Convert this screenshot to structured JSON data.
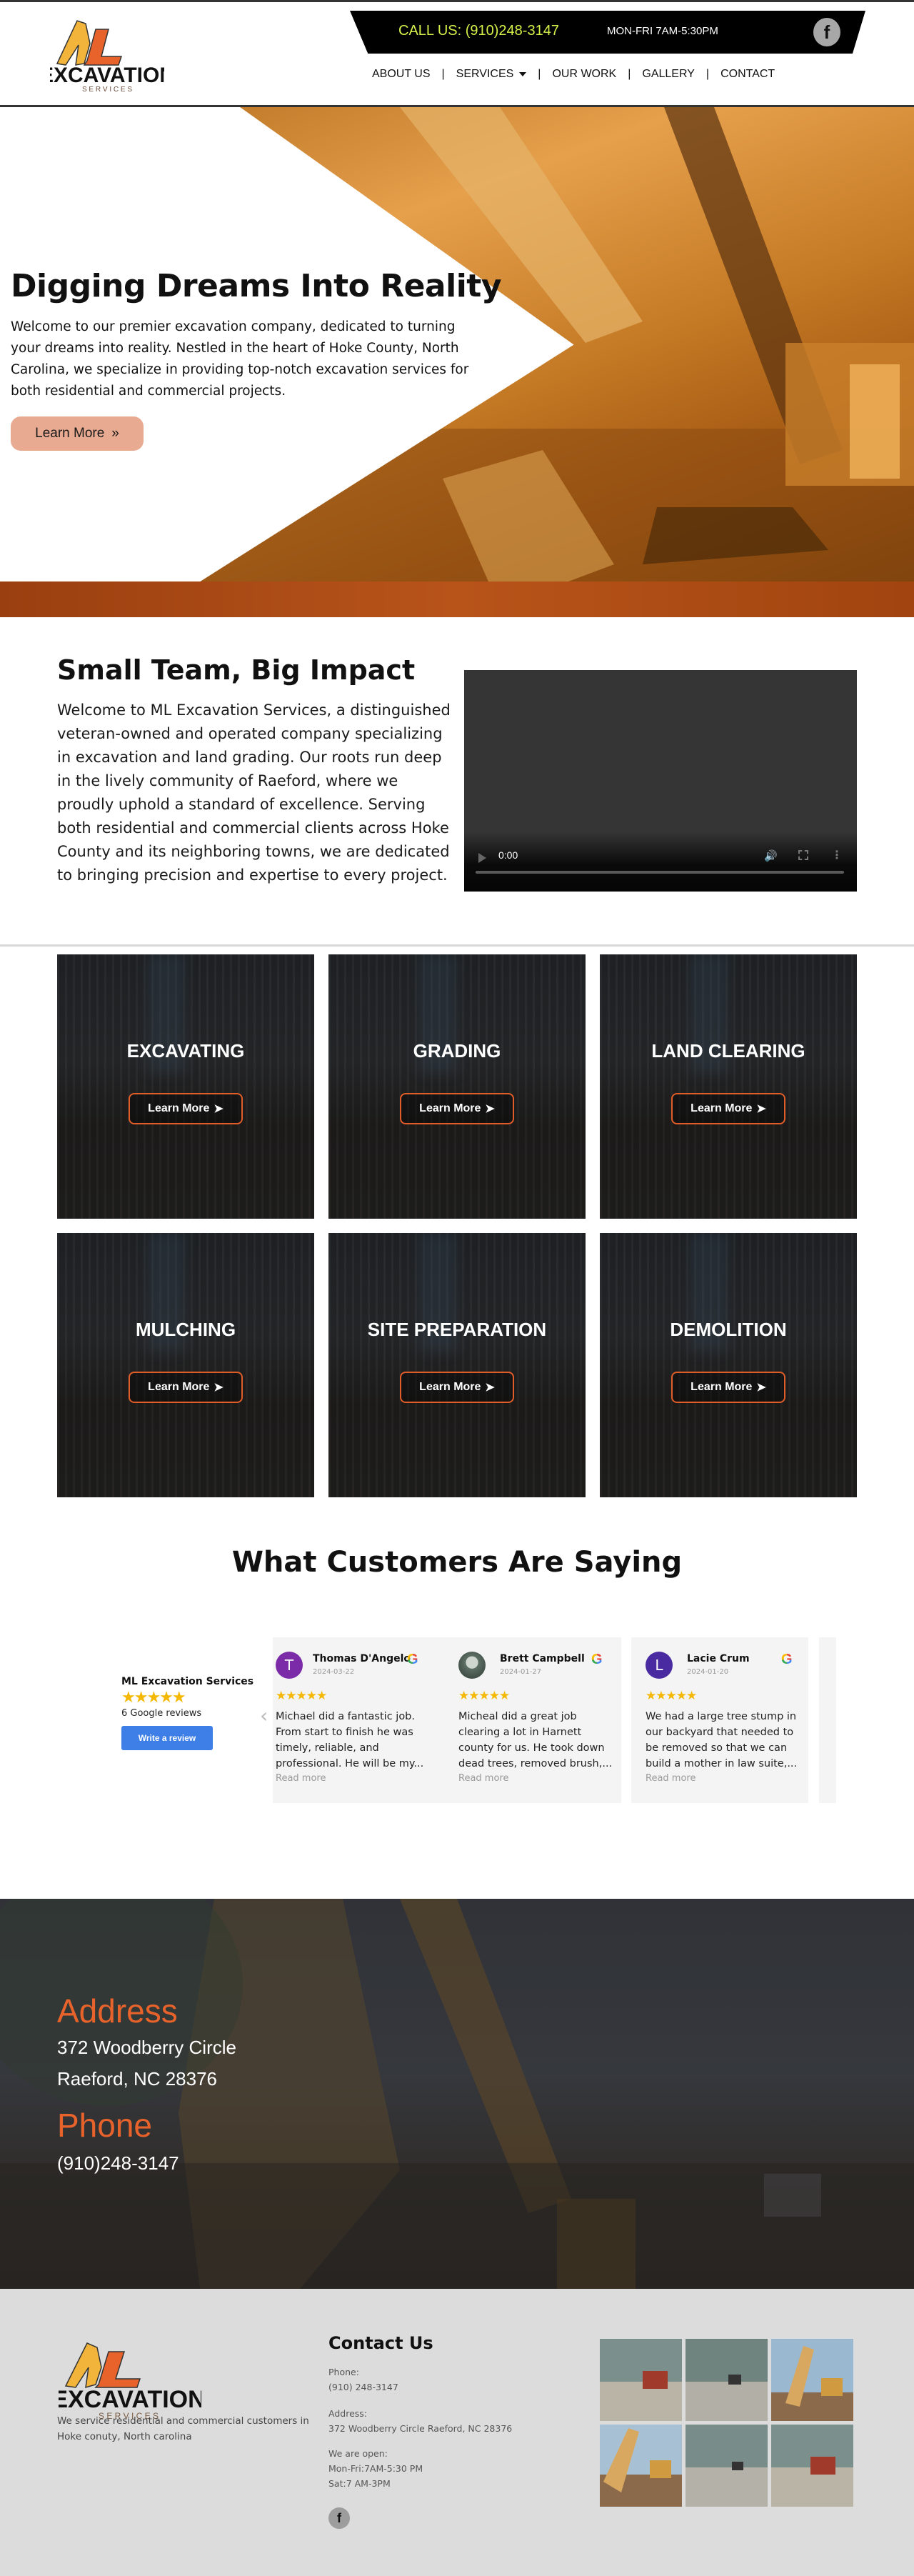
{
  "header": {
    "logo_alt": "ML Excavation Services logo",
    "logo_main": "EXCAVATION",
    "logo_sub": "S E R V I C E S",
    "call_us": "CALL US: (910)248-3147",
    "hours": "MON-FRI 7AM-5:30PM",
    "facebook_glyph": "f",
    "nav": [
      {
        "label": "ABOUT US"
      },
      {
        "label": "SERVICES",
        "has_dropdown": true
      },
      {
        "label": "OUR WORK"
      },
      {
        "label": "GALLERY"
      },
      {
        "label": "CONTACT"
      }
    ],
    "nav_separator": "|"
  },
  "hero": {
    "title": "Digging Dreams Into Reality",
    "text": "Welcome to our premier excavation company, dedicated to turning your dreams into reality. Nestled in the heart of Hoke County, North Carolina, we specialize in providing top-notch excavation services for both residential and commercial projects.",
    "button_label": "Learn More",
    "button_icon": "»"
  },
  "about": {
    "title": "Small Team, Big Impact",
    "text": "Welcome to ML Excavation Services, a distinguished veteran-owned and operated company specializing in excavation and land grading. Our roots run deep in the lively community of Raeford, where we proudly uphold a standard of excellence. Serving both residential and commercial clients across Hoke County and its neighboring towns, we are dedicated to bringing precision and expertise to every project.",
    "video": {
      "time": "0:00",
      "progress": 0
    }
  },
  "services": {
    "button_label": "Learn More",
    "items": [
      {
        "title": "EXCAVATING"
      },
      {
        "title": "GRADING"
      },
      {
        "title": "LAND CLEARING"
      },
      {
        "title": "MULCHING"
      },
      {
        "title": "SITE PREPARATION"
      },
      {
        "title": "DEMOLITION"
      }
    ]
  },
  "reviews": {
    "title": "What Customers Are Saying",
    "company": "ML Excavation Services",
    "rating_stars": "★★★★★",
    "count_label": "6 Google reviews",
    "write_label": "Write a review",
    "prev_glyph": "‹",
    "read_more": "Read more",
    "items": [
      {
        "initial": "T",
        "avatar_color": "#7b2aa8",
        "name": "Thomas D'Angelo",
        "date": "2024-03-22",
        "stars": "★★★★★",
        "text": "Michael did a fantastic job. From start to finish he was timely, reliable, and professional. He will be my..."
      },
      {
        "initial": "",
        "avatar_color": "#4a5a50",
        "name": "Brett Campbell",
        "date": "2024-01-27",
        "stars": "★★★★★",
        "text": "Micheal did a great job clearing a lot in Harnett county for us. He took down dead trees, removed brush,..."
      },
      {
        "initial": "L",
        "avatar_color": "#4a2aa0",
        "name": "Lacie Crum",
        "date": "2024-01-20",
        "stars": "★★★★★",
        "text": "We had a large tree stump in our backyard that needed to be removed so that we can build a mother in law suite,..."
      }
    ]
  },
  "contact_band": {
    "address_heading": "Address",
    "address_line1": "372 Woodberry Circle",
    "address_line2": "Raeford, NC 28376",
    "phone_heading": "Phone",
    "phone": "(910)248-3147"
  },
  "footer": {
    "description": "We service residential and commercial customers in Hoke conuty, North carolina",
    "contact_title": "Contact Us",
    "phone_label": "Phone:",
    "phone": "(910) 248-3147",
    "address_label": "Address:",
    "address": "372 Woodberry Circle Raeford, NC 28376",
    "open_label": "We are open:",
    "hours_weekday": "Mon-Fri:7AM-5:30 PM",
    "hours_sat": "Sat:7 AM-3PM",
    "facebook_glyph": "f",
    "gallery_count": 6
  },
  "colors": {
    "accent_orange": "#e8632b",
    "call_us_yellow": "#d6f04a",
    "review_button_blue": "#3d7fe6",
    "star_gold": "#f5b800"
  }
}
